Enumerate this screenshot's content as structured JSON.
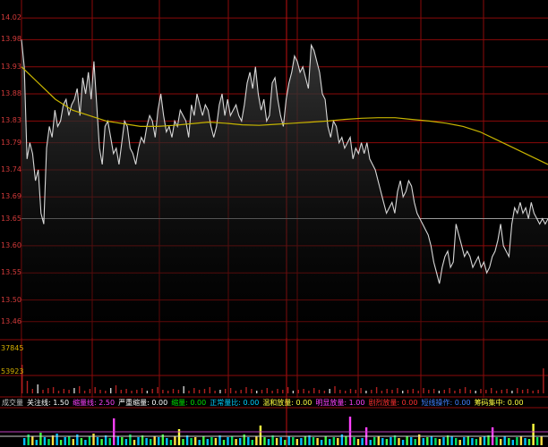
{
  "colors": {
    "background": "#000000",
    "grid": "#8b0a0a",
    "price_line": "#d8d8d8",
    "avg_line": "#c8b400",
    "ref_line": "#9a9a9a",
    "area_top": "#3c3c3c",
    "axis_text": "#d23a3a",
    "vol_text": "#d4b000"
  },
  "chart_data": [
    {
      "type": "line",
      "title": "",
      "xlabel": "",
      "ylabel": "",
      "y_ticks": [
        "14.02",
        "13.98",
        "13.93",
        "13.88",
        "13.83",
        "13.79",
        "13.74",
        "13.69",
        "13.65",
        "13.60",
        "13.55",
        "13.50",
        "13.46"
      ],
      "ylim": [
        13.43,
        14.04
      ],
      "grid": true,
      "series": [
        {
          "role": "price",
          "values": [
            13.98,
            13.93,
            13.76,
            13.79,
            13.77,
            13.72,
            13.74,
            13.66,
            13.64,
            13.78,
            13.82,
            13.8,
            13.85,
            13.82,
            13.83,
            13.86,
            13.87,
            13.84,
            13.86,
            13.87,
            13.89,
            13.84,
            13.91,
            13.88,
            13.92,
            13.87,
            13.94,
            13.86,
            13.78,
            13.75,
            13.82,
            13.83,
            13.8,
            13.77,
            13.78,
            13.75,
            13.79,
            13.83,
            13.82,
            13.78,
            13.77,
            13.75,
            13.78,
            13.8,
            13.79,
            13.82,
            13.84,
            13.83,
            13.8,
            13.85,
            13.88,
            13.84,
            13.81,
            13.82,
            13.8,
            13.83,
            13.82,
            13.85,
            13.84,
            13.83,
            13.8,
            13.86,
            13.84,
            13.88,
            13.86,
            13.84,
            13.86,
            13.85,
            13.82,
            13.8,
            13.82,
            13.86,
            13.88,
            13.84,
            13.87,
            13.84,
            13.85,
            13.86,
            13.84,
            13.83,
            13.86,
            13.9,
            13.92,
            13.89,
            13.93,
            13.88,
            13.85,
            13.87,
            13.83,
            13.84,
            13.9,
            13.91,
            13.87,
            13.84,
            13.82,
            13.87,
            13.9,
            13.92,
            13.95,
            13.94,
            13.92,
            13.93,
            13.91,
            13.89,
            13.97,
            13.96,
            13.94,
            13.92,
            13.88,
            13.87,
            13.82,
            13.8,
            13.83,
            13.82,
            13.79,
            13.8,
            13.78,
            13.79,
            13.8,
            13.76,
            13.78,
            13.77,
            13.79,
            13.77,
            13.79,
            13.76,
            13.75,
            13.74,
            13.72,
            13.7,
            13.68,
            13.66,
            13.67,
            13.68,
            13.66,
            13.7,
            13.72,
            13.69,
            13.7,
            13.72,
            13.71,
            13.68,
            13.66,
            13.65,
            13.64,
            13.63,
            13.62,
            13.6,
            13.57,
            13.55,
            13.53,
            13.56,
            13.58,
            13.59,
            13.56,
            13.57,
            13.64,
            13.62,
            13.6,
            13.58,
            13.59,
            13.58,
            13.56,
            13.57,
            13.58,
            13.56,
            13.57,
            13.55,
            13.56,
            13.58,
            13.59,
            13.61,
            13.64,
            13.6,
            13.59,
            13.58,
            13.64,
            13.67,
            13.66,
            13.68,
            13.66,
            13.67,
            13.65,
            13.68,
            13.66,
            13.65,
            13.64,
            13.65,
            13.64,
            13.65
          ]
        },
        {
          "role": "average",
          "values": [
            13.93,
            13.9,
            13.87,
            13.85,
            13.84,
            13.83,
            13.825,
            13.82,
            13.82,
            13.822,
            13.825,
            13.828,
            13.826,
            13.823,
            13.822,
            13.824,
            13.826,
            13.828,
            13.83,
            13.833,
            13.835,
            13.836,
            13.836,
            13.833,
            13.83,
            13.826,
            13.82,
            13.81,
            13.795,
            13.78,
            13.765,
            13.75
          ]
        }
      ],
      "reference_value": 13.65
    },
    {
      "type": "bar",
      "title": "",
      "y_ticks": [
        "37845",
        "53923"
      ],
      "values": [
        32,
        14,
        5,
        10,
        4,
        6,
        7,
        3,
        5,
        4,
        6,
        8,
        3,
        5,
        7,
        4,
        3,
        6,
        9,
        4,
        5,
        3,
        4,
        6,
        3,
        5,
        7,
        4,
        3,
        5,
        4,
        8,
        3,
        6,
        4,
        5,
        7,
        3,
        4,
        5,
        6,
        3,
        4,
        7,
        5,
        3,
        4,
        6,
        3,
        5,
        4,
        7,
        3,
        4,
        5,
        3,
        6,
        4,
        3,
        5,
        8,
        4,
        3,
        5,
        4,
        6,
        3,
        4,
        7,
        3,
        5,
        4,
        6,
        3,
        4,
        5,
        3,
        6,
        4,
        5,
        3,
        4,
        6,
        3,
        5,
        7,
        4,
        3,
        5,
        4,
        6,
        3,
        4,
        5,
        3,
        6,
        4,
        5,
        3,
        4,
        28
      ]
    },
    {
      "type": "bar",
      "title": "",
      "values": [
        8,
        12,
        10,
        6,
        14,
        9,
        7,
        11,
        13,
        6,
        9,
        10,
        7,
        12,
        8,
        6,
        10,
        13,
        9,
        7,
        11,
        8,
        24,
        10,
        9,
        7,
        12,
        6,
        9,
        11,
        8,
        7,
        10,
        9,
        12,
        8,
        6,
        10,
        9,
        7,
        11,
        8,
        9,
        6,
        10,
        7,
        9,
        8,
        11,
        6,
        9,
        10,
        7,
        8,
        12,
        9,
        6,
        10,
        8,
        9,
        7,
        11,
        8,
        9,
        6,
        10,
        9,
        7,
        8,
        10,
        11,
        9,
        8,
        6,
        10,
        7,
        9,
        8,
        12,
        10,
        24,
        9,
        7,
        8,
        11,
        6,
        9,
        10,
        8,
        7,
        9,
        11,
        8,
        6,
        10,
        9,
        7,
        12,
        8,
        9,
        10,
        8,
        7,
        9,
        11,
        10,
        8,
        6,
        9,
        10,
        8,
        7,
        9,
        10,
        11,
        8,
        9,
        7,
        10,
        8,
        6,
        9,
        10,
        8,
        7,
        12,
        9,
        10
      ],
      "highlight_bars": [
        {
          "index": 22,
          "value": 30,
          "color": "#ff40ff"
        },
        {
          "index": 80,
          "value": 32,
          "color": "#ff40ff"
        },
        {
          "index": 84,
          "value": 20,
          "color": "#ff40ff"
        },
        {
          "index": 38,
          "value": 18,
          "color": "#ffff40"
        },
        {
          "index": 58,
          "value": 22,
          "color": "#ffff40"
        },
        {
          "index": 115,
          "value": 20,
          "color": "#ff40ff"
        },
        {
          "index": 125,
          "value": 24,
          "color": "#ffff40"
        }
      ]
    }
  ],
  "legend": [
    {
      "text": "成交量",
      "color": "#c0c0c0"
    },
    {
      "text": "关注线: 1.50",
      "color": "#ffffff"
    },
    {
      "text": "缩量线: 2.50",
      "color": "#ff40ff"
    },
    {
      "text": "严重缩量: 0.00",
      "color": "#ffffff"
    },
    {
      "text": "缩量: 0.00",
      "color": "#00e000"
    },
    {
      "text": "正常量比: 0.00",
      "color": "#00d0ff"
    },
    {
      "text": "温和放量: 0.00",
      "color": "#ffff40"
    },
    {
      "text": "明显放量: 1.00",
      "color": "#ff40ff"
    },
    {
      "text": "剧烈放量: 0.00",
      "color": "#ff3030"
    },
    {
      "text": "短线操作: 0.00",
      "color": "#4080ff"
    },
    {
      "text": "筹码集中: 0.00",
      "color": "#ffff40"
    }
  ]
}
